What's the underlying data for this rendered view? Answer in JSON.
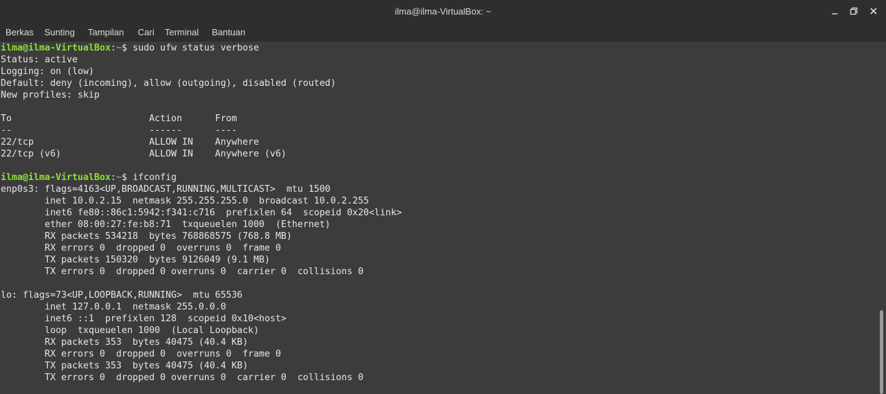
{
  "window": {
    "title": "ilma@ilma-VirtualBox: ~"
  },
  "menu": {
    "items": [
      "Berkas",
      "Sunting",
      "Tampilan",
      "Cari",
      "Terminal",
      "Bantuan"
    ]
  },
  "terminal": {
    "prompt_user": "ilma@ilma-VirtualBox",
    "prompt_sep": ":",
    "prompt_path": "~",
    "prompt_end": "$ ",
    "colors": {
      "background": "#3c3c3c",
      "text": "#e6e6e6",
      "user": "#8ae234",
      "path": "#729fcf"
    },
    "lines": [
      {
        "type": "prompt",
        "cmd": "sudo ufw status verbose"
      },
      {
        "type": "text",
        "text": "Status: active"
      },
      {
        "type": "text",
        "text": "Logging: on (low)"
      },
      {
        "type": "text",
        "text": "Default: deny (incoming), allow (outgoing), disabled (routed)"
      },
      {
        "type": "text",
        "text": "New profiles: skip"
      },
      {
        "type": "text",
        "text": ""
      },
      {
        "type": "text",
        "text": "To                         Action      From"
      },
      {
        "type": "text",
        "text": "--                         ------      ----"
      },
      {
        "type": "text",
        "text": "22/tcp                     ALLOW IN    Anywhere"
      },
      {
        "type": "text",
        "text": "22/tcp (v6)                ALLOW IN    Anywhere (v6)"
      },
      {
        "type": "text",
        "text": ""
      },
      {
        "type": "prompt",
        "cmd": "ifconfig"
      },
      {
        "type": "text",
        "text": "enp0s3: flags=4163<UP,BROADCAST,RUNNING,MULTICAST>  mtu 1500"
      },
      {
        "type": "text",
        "text": "        inet 10.0.2.15  netmask 255.255.255.0  broadcast 10.0.2.255"
      },
      {
        "type": "text",
        "text": "        inet6 fe80::86c1:5942:f341:c716  prefixlen 64  scopeid 0x20<link>"
      },
      {
        "type": "text",
        "text": "        ether 08:00:27:fe:b8:71  txqueuelen 1000  (Ethernet)"
      },
      {
        "type": "text",
        "text": "        RX packets 534218  bytes 768868575 (768.8 MB)"
      },
      {
        "type": "text",
        "text": "        RX errors 0  dropped 0  overruns 0  frame 0"
      },
      {
        "type": "text",
        "text": "        TX packets 150320  bytes 9126049 (9.1 MB)"
      },
      {
        "type": "text",
        "text": "        TX errors 0  dropped 0 overruns 0  carrier 0  collisions 0"
      },
      {
        "type": "text",
        "text": ""
      },
      {
        "type": "text",
        "text": "lo: flags=73<UP,LOOPBACK,RUNNING>  mtu 65536"
      },
      {
        "type": "text",
        "text": "        inet 127.0.0.1  netmask 255.0.0.0"
      },
      {
        "type": "text",
        "text": "        inet6 ::1  prefixlen 128  scopeid 0x10<host>"
      },
      {
        "type": "text",
        "text": "        loop  txqueuelen 1000  (Local Loopback)"
      },
      {
        "type": "text",
        "text": "        RX packets 353  bytes 40475 (40.4 KB)"
      },
      {
        "type": "text",
        "text": "        RX errors 0  dropped 0  overruns 0  frame 0"
      },
      {
        "type": "text",
        "text": "        TX packets 353  bytes 40475 (40.4 KB)"
      },
      {
        "type": "text",
        "text": "        TX errors 0  dropped 0 overruns 0  carrier 0  collisions 0"
      }
    ]
  }
}
